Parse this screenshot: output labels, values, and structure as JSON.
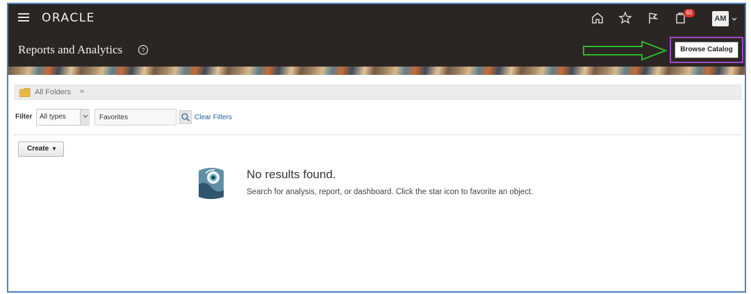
{
  "header": {
    "logo": "ORACLE",
    "icons": [
      "hamburger-menu-icon",
      "home-icon",
      "star-icon",
      "flag-icon",
      "notifications-icon"
    ],
    "notification_count": "65",
    "avatar_initials": "AM"
  },
  "subheader": {
    "title": "Reports and Analytics",
    "browse_catalog_label": "Browse Catalog"
  },
  "breadcrumb": {
    "label": "All Folders",
    "chevron": "»"
  },
  "filter": {
    "label": "Filter",
    "type_value": "All types",
    "search_value": "Favorites",
    "clear_label": "Clear Filters"
  },
  "toolbar": {
    "create_label": "Create"
  },
  "empty_state": {
    "title": "No results found.",
    "description": "Search for analysis, report, or dashboard. Click the star icon to favorite an object."
  },
  "colors": {
    "header_bg": "#2b2623",
    "arrow_green": "#2db82a",
    "highlight_purple": "#a149c8",
    "link_blue": "#1f5fa0",
    "badge_red": "#d7322a"
  }
}
